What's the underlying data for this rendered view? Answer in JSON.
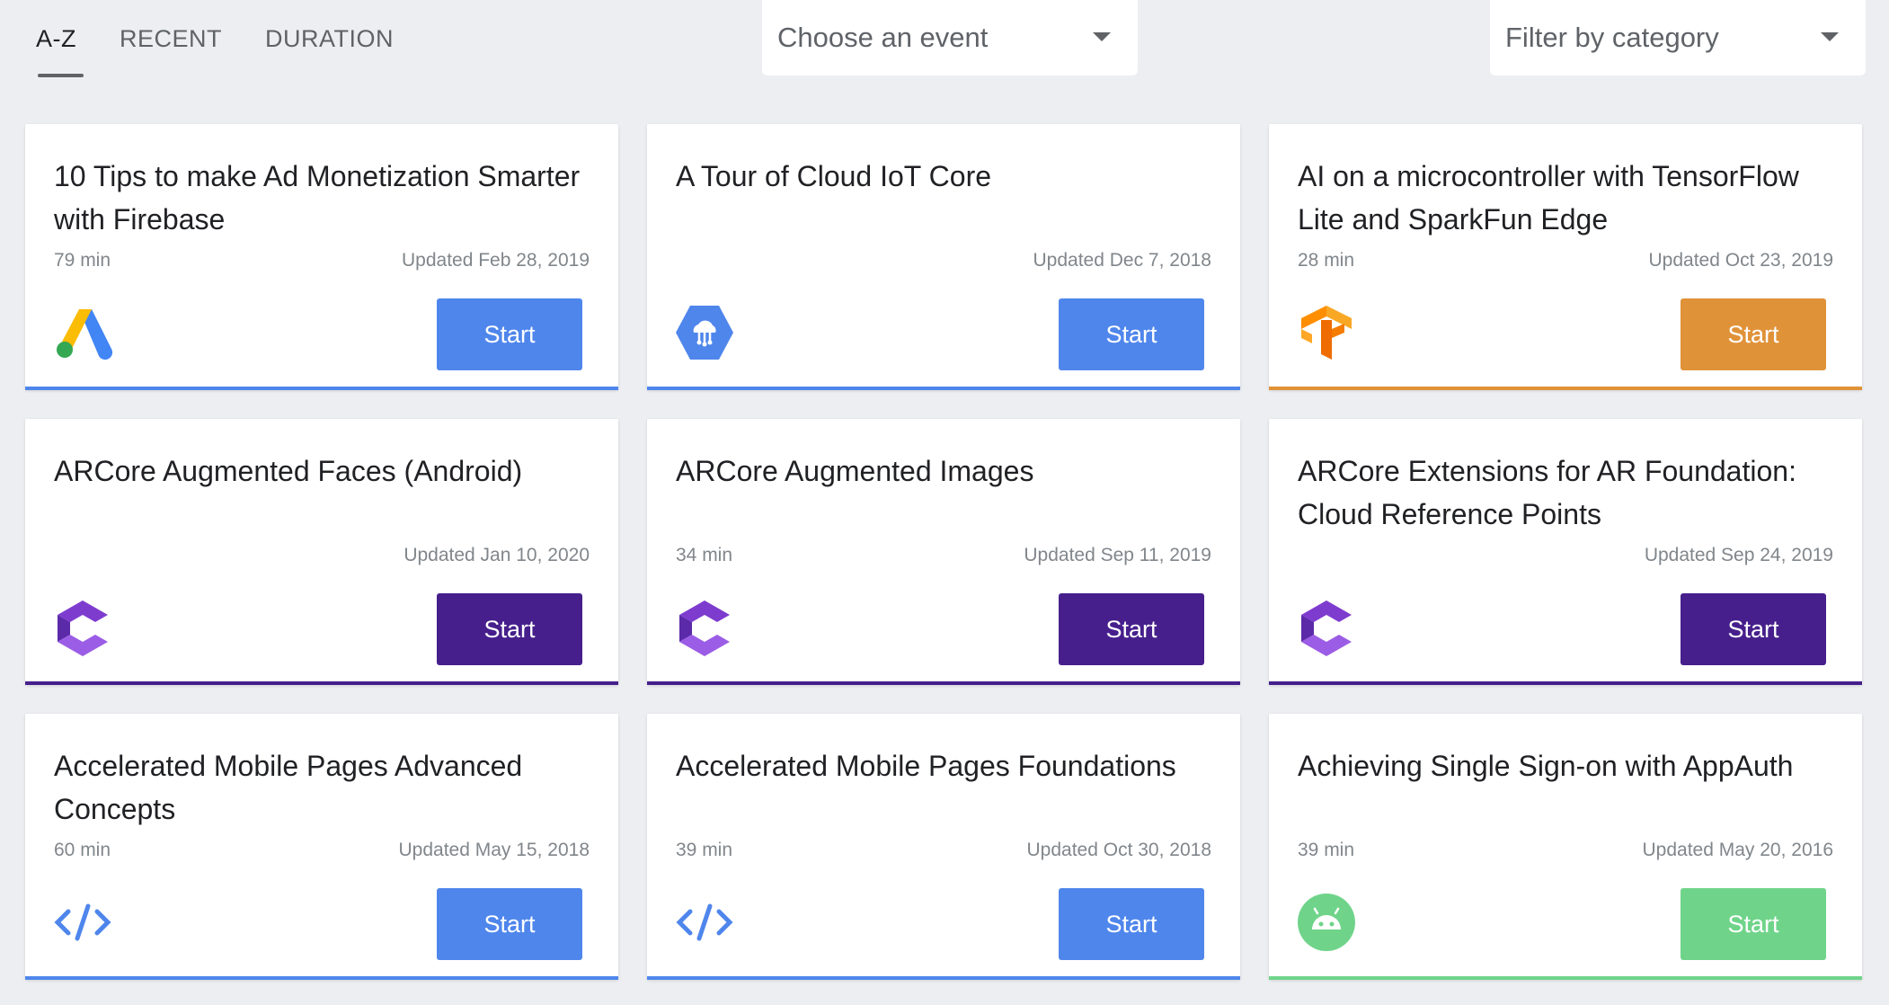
{
  "tabs": [
    {
      "label": "A-Z",
      "active": true
    },
    {
      "label": "RECENT",
      "active": false
    },
    {
      "label": "DURATION",
      "active": false
    }
  ],
  "event_select": {
    "value": "Choose an event"
  },
  "category_select": {
    "value": "Filter by category"
  },
  "colors": {
    "blue": "#4f86ec",
    "purple": "#461f8c",
    "orange": "#e09239",
    "green": "#6fd48a"
  },
  "cards": [
    {
      "title": "10 Tips to make Ad Monetization Smarter with Firebase",
      "duration": "79 min",
      "updated": "Updated Feb 28, 2019",
      "button": "Start",
      "color": "#4f86ec",
      "icon": "google-ads-icon"
    },
    {
      "title": "A Tour of Cloud IoT Core",
      "duration": "",
      "updated": "Updated Dec 7, 2018",
      "button": "Start",
      "color": "#4f86ec",
      "icon": "cloud-iot-icon"
    },
    {
      "title": "AI on a microcontroller with TensorFlow Lite and SparkFun Edge",
      "duration": "28 min",
      "updated": "Updated Oct 23, 2019",
      "button": "Start",
      "color": "#e09239",
      "icon": "tensorflow-icon"
    },
    {
      "title": "ARCore Augmented Faces (Android)",
      "duration": "",
      "updated": "Updated Jan 10, 2020",
      "button": "Start",
      "color": "#461f8c",
      "icon": "arcore-icon"
    },
    {
      "title": "ARCore Augmented Images",
      "duration": "34 min",
      "updated": "Updated Sep 11, 2019",
      "button": "Start",
      "color": "#461f8c",
      "icon": "arcore-icon"
    },
    {
      "title": "ARCore Extensions for AR Foundation: Cloud Reference Points",
      "duration": "",
      "updated": "Updated Sep 24, 2019",
      "button": "Start",
      "color": "#461f8c",
      "icon": "arcore-icon"
    },
    {
      "title": "Accelerated Mobile Pages Advanced Concepts",
      "duration": "60 min",
      "updated": "Updated May 15, 2018",
      "button": "Start",
      "color": "#4f86ec",
      "icon": "code-icon"
    },
    {
      "title": "Accelerated Mobile Pages Foundations",
      "duration": "39 min",
      "updated": "Updated Oct 30, 2018",
      "button": "Start",
      "color": "#4f86ec",
      "icon": "code-icon"
    },
    {
      "title": "Achieving Single Sign-on with AppAuth",
      "duration": "39 min",
      "updated": "Updated May 20, 2016",
      "button": "Start",
      "color": "#6fd48a",
      "icon": "android-icon"
    }
  ]
}
